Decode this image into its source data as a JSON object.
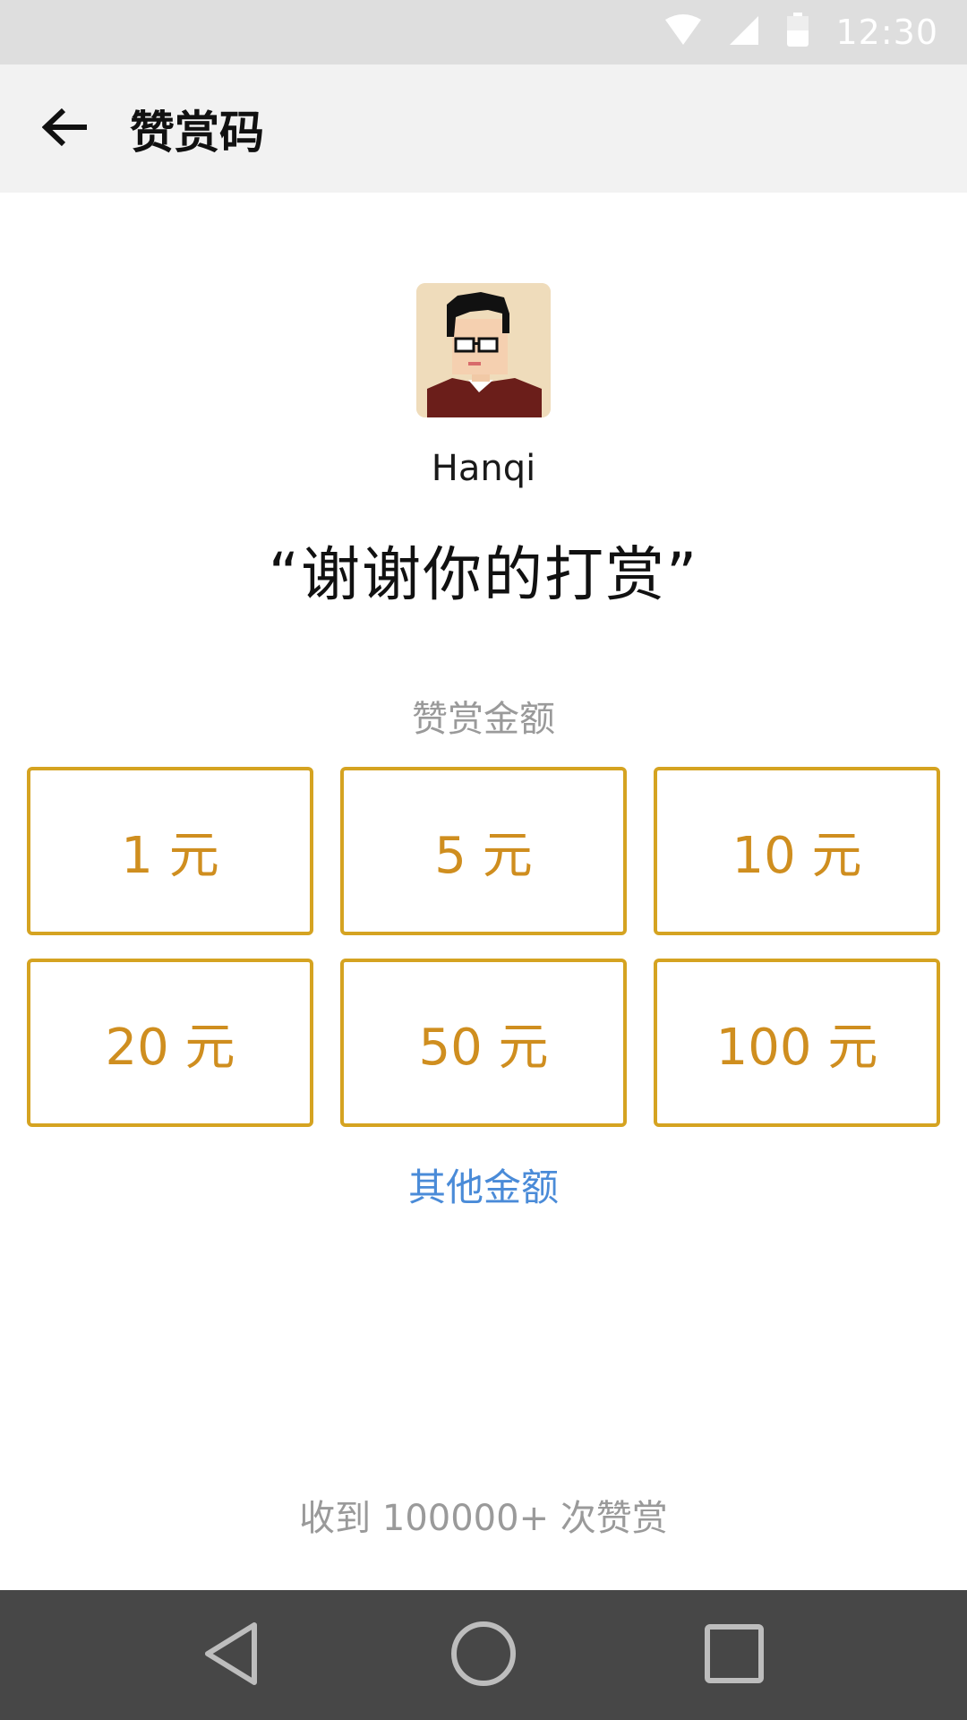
{
  "status_bar": {
    "time": "12:30"
  },
  "app_bar": {
    "title": "赞赏码"
  },
  "profile": {
    "username": "Hanqi",
    "message": "“谢谢你的打赏”"
  },
  "amount_section": {
    "label": "赞赏金额",
    "options": [
      "1 元",
      "5 元",
      "10 元",
      "20 元",
      "50 元",
      "100 元"
    ],
    "other": "其他金额"
  },
  "footer": {
    "received": "收到 100000+ 次赞赏"
  },
  "colors": {
    "accent_border": "#d5a321",
    "accent_text": "#cf8e1f",
    "link": "#4a8bd8",
    "nav_bar": "#474747"
  },
  "icons": {
    "status": [
      "wifi-icon",
      "signal-icon",
      "battery-icon"
    ],
    "nav": [
      "back-triangle-icon",
      "home-circle-icon",
      "recents-square-icon"
    ]
  }
}
